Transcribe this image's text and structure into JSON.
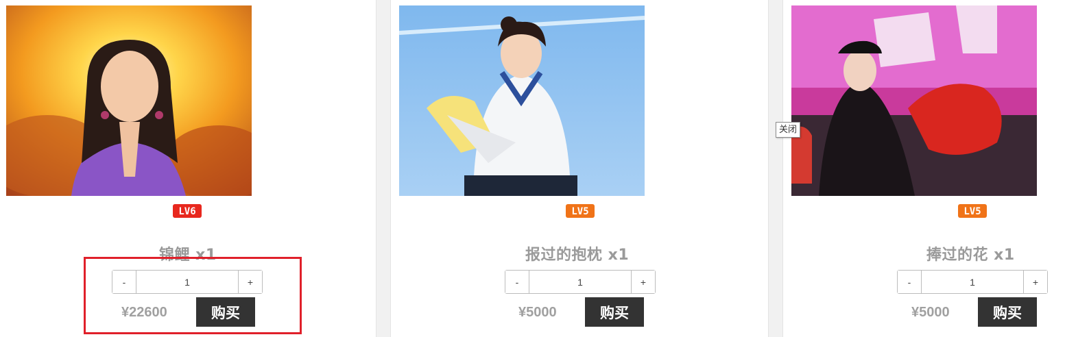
{
  "products": [
    {
      "title": "锦鲤 x1",
      "level": "LV6",
      "level_color": "#e8281e",
      "quantity": "1",
      "minus_label": "-",
      "plus_label": "+",
      "price": "¥22600",
      "buy_label": "购买"
    },
    {
      "title": "报过的抱枕 x1",
      "level": "LV5",
      "level_color": "#f07318",
      "quantity": "1",
      "minus_label": "-",
      "plus_label": "+",
      "price": "¥5000",
      "buy_label": "购买"
    },
    {
      "title": "捧过的花 x1",
      "level": "LV5",
      "level_color": "#f07318",
      "quantity": "1",
      "minus_label": "-",
      "plus_label": "+",
      "price": "¥5000",
      "buy_label": "购买"
    }
  ],
  "tooltip": {
    "text": "关闭"
  },
  "colors": {
    "highlight": "#e0202a",
    "buy_button": "#333333"
  }
}
